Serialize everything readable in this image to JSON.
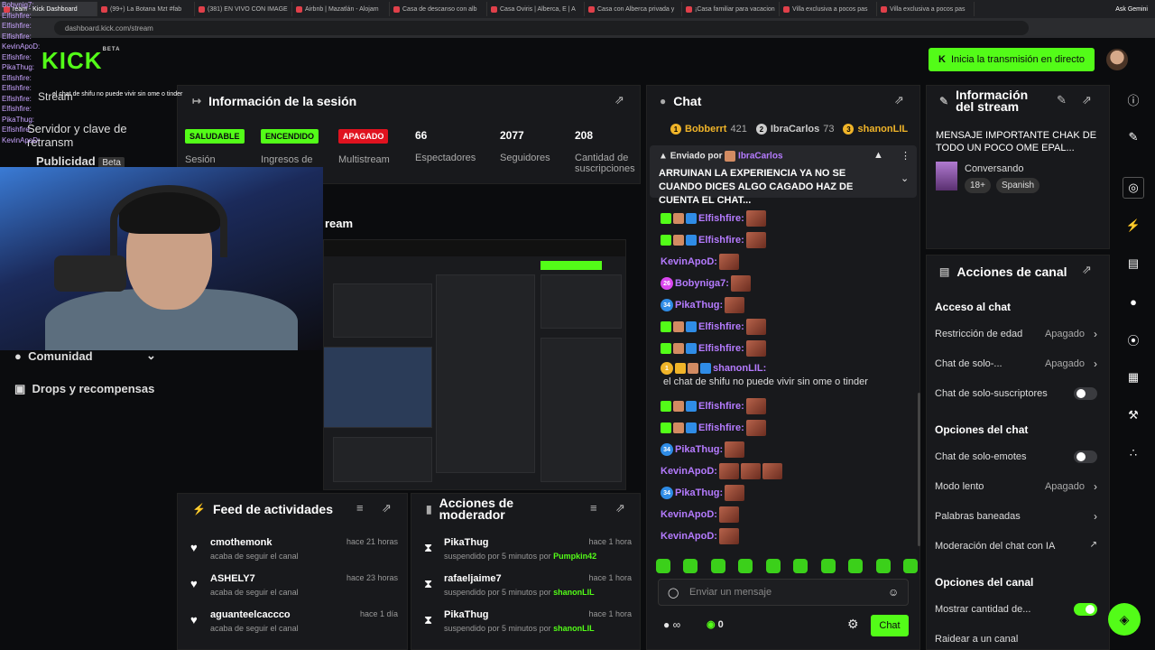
{
  "browser": {
    "tabs": [
      "ream - Kick Dashboard",
      "(99+) La Botana Mzt #fab",
      "(381) EN VIVO CON IMAGE",
      "Airbnb | Mazatlán - Alojam",
      "Casa de descanso con alb",
      "Casa Oviris | Alberca, E | A",
      "Casa con Alberca privada y",
      "¡Casa familiar para vacacion",
      "Villa exclusiva a pocos pas",
      "Villa exclusiva a pocos pas"
    ],
    "gemini": "Ask Gemini",
    "url": "dashboard.kick.com/stream"
  },
  "overlay_chat": [
    "Bobynig7:",
    "Elfishfire:",
    "Elfishfire:",
    "Elfishfire:",
    "KevinApoD:",
    "Elfishfire:",
    "PikaThug:",
    "Elfishfire:",
    "Elfishfire:",
    "Elfishfire:",
    "Elfishfire:",
    "PikaThug:",
    "Elfishfire:",
    "KevinApoD:"
  ],
  "overlay_msg": "el chat de shifu no puede vivir sin ome o tinder",
  "logo": {
    "text": "KICK",
    "tag": "BETA"
  },
  "go_live": "Inicia la transmisión en directo",
  "sidenav": {
    "stream": "Stream",
    "servidor": "Servidor y clave de retransm",
    "publicidad": "Publicidad",
    "beta": "Beta",
    "comunidad": "Comunidad",
    "drops": "Drops y recompensas"
  },
  "session": {
    "title": "Información de la sesión",
    "badges": [
      {
        "label": "SALUDABLE",
        "sub": "Sesión",
        "color": "#53fc18"
      },
      {
        "label": "ENCENDIDO",
        "sub": "Ingresos de",
        "color": "#53fc18"
      },
      {
        "label": "APAGADO",
        "sub": "Multistream",
        "color": "#e0121f"
      }
    ],
    "stats": [
      {
        "num": "66",
        "label": "Espectadores"
      },
      {
        "num": "2077",
        "label": "Seguidores"
      },
      {
        "num": "208",
        "label": "Cantidad de suscripciones"
      }
    ]
  },
  "stream_preview_title": "ream",
  "activity": {
    "title": "Feed de actividades",
    "items": [
      {
        "name": "cmothemonk",
        "sub": "acaba de seguir el canal",
        "time": "hace 21 horas"
      },
      {
        "name": "ASHELY7",
        "sub": "acaba de seguir el canal",
        "time": "hace 23 horas"
      },
      {
        "name": "aguanteelcaccco",
        "sub": "acaba de seguir el canal",
        "time": "hace 1 día"
      }
    ]
  },
  "moderator": {
    "title": "Acciones de moderador",
    "items": [
      {
        "name": "PikaThug",
        "sub": "suspendido por 5 minutos por",
        "by": "Pumpkin42",
        "time": "hace 1 hora"
      },
      {
        "name": "rafaeljaime7",
        "sub": "suspendido por 5 minutos por",
        "by": "shanonLIL",
        "time": "hace 1 hora"
      },
      {
        "name": "PikaThug",
        "sub": "suspendido por 5 minutos por",
        "by": "shanonLIL",
        "time": "hace 1 hora"
      }
    ]
  },
  "chat": {
    "title": "Chat",
    "top": [
      {
        "name": "Bobberrt",
        "count": "421",
        "rank": "1",
        "color": "#f0b429"
      },
      {
        "name": "IbraCarlos",
        "count": "73",
        "rank": "2",
        "color": "#ccc"
      },
      {
        "name": "shanonLIL",
        "count": "",
        "rank": "3",
        "color": "#f0b429"
      }
    ],
    "pinned": {
      "label": "Enviado por",
      "user": "IbraCarlos",
      "text": "ARRUINAN LA EXPERIENCIA YA NO SE CUANDO DICES ALGO CAGADO HAZ DE CUENTA EL CHAT..."
    },
    "messages": [
      {
        "user": "Elfishfire:",
        "color": "#b57bff",
        "emotes": 1
      },
      {
        "user": "Elfishfire:",
        "color": "#b57bff",
        "emotes": 1
      },
      {
        "user": "KevinApoD:",
        "color": "#b57bff",
        "emotes": 1
      },
      {
        "user": "Bobyniga7:",
        "color": "#b57bff",
        "emotes": 1
      },
      {
        "user": "PikaThug:",
        "color": "#b57bff",
        "emotes": 1
      },
      {
        "user": "Elfishfire:",
        "color": "#b57bff",
        "emotes": 1
      },
      {
        "user": "Elfishfire:",
        "color": "#b57bff",
        "emotes": 1
      },
      {
        "user": "shanonLIL:",
        "color": "#b57bff",
        "text": "el chat de shifu no puede vivir sin ome o tinder"
      },
      {
        "user": "Elfishfire:",
        "color": "#b57bff",
        "emotes": 1
      },
      {
        "user": "Elfishfire:",
        "color": "#b57bff",
        "emotes": 1
      },
      {
        "user": "PikaThug:",
        "color": "#b57bff",
        "emotes": 1
      },
      {
        "user": "KevinApoD:",
        "color": "#b57bff",
        "emotes": 3
      },
      {
        "user": "PikaThug:",
        "color": "#b57bff",
        "emotes": 1
      },
      {
        "user": "KevinApoD:",
        "color": "#b57bff",
        "emotes": 1
      },
      {
        "user": "KevinApoD:",
        "color": "#b57bff",
        "emotes": 1
      }
    ],
    "badge_34": "34",
    "badge_26": "26",
    "badge_1": "1",
    "placeholder": "Enviar un mensaje",
    "count": "0",
    "send": "Chat"
  },
  "stream_info": {
    "title": "Información del stream",
    "message": "MENSAJE IMPORTANTE CHAK DE TODO UN POCO OME EPAL...",
    "category": "Conversando",
    "tags": [
      "18+",
      "Spanish"
    ]
  },
  "channel_actions": {
    "title": "Acciones de canal",
    "sections": [
      {
        "head": "Acceso al chat",
        "items": [
          {
            "label": "Restricción de edad",
            "val": "Apagado",
            "kind": "chev"
          },
          {
            "label": "Chat de solo-...",
            "val": "Apagado",
            "kind": "chev"
          },
          {
            "label": "Chat de solo-suscriptores",
            "kind": "toggle",
            "on": false
          }
        ]
      },
      {
        "head": "Opciones del chat",
        "items": [
          {
            "label": "Chat de solo-emotes",
            "kind": "toggle",
            "on": false
          },
          {
            "label": "Modo lento",
            "val": "Apagado",
            "kind": "chev"
          },
          {
            "label": "Palabras baneadas",
            "kind": "chev"
          },
          {
            "label": "Moderación del chat con IA",
            "kind": "ext"
          }
        ]
      },
      {
        "head": "Opciones del canal",
        "items": [
          {
            "label": "Mostrar cantidad de...",
            "kind": "toggle",
            "on": true
          },
          {
            "label": "Raidear a un canal",
            "kind": "none"
          }
        ]
      }
    ]
  }
}
